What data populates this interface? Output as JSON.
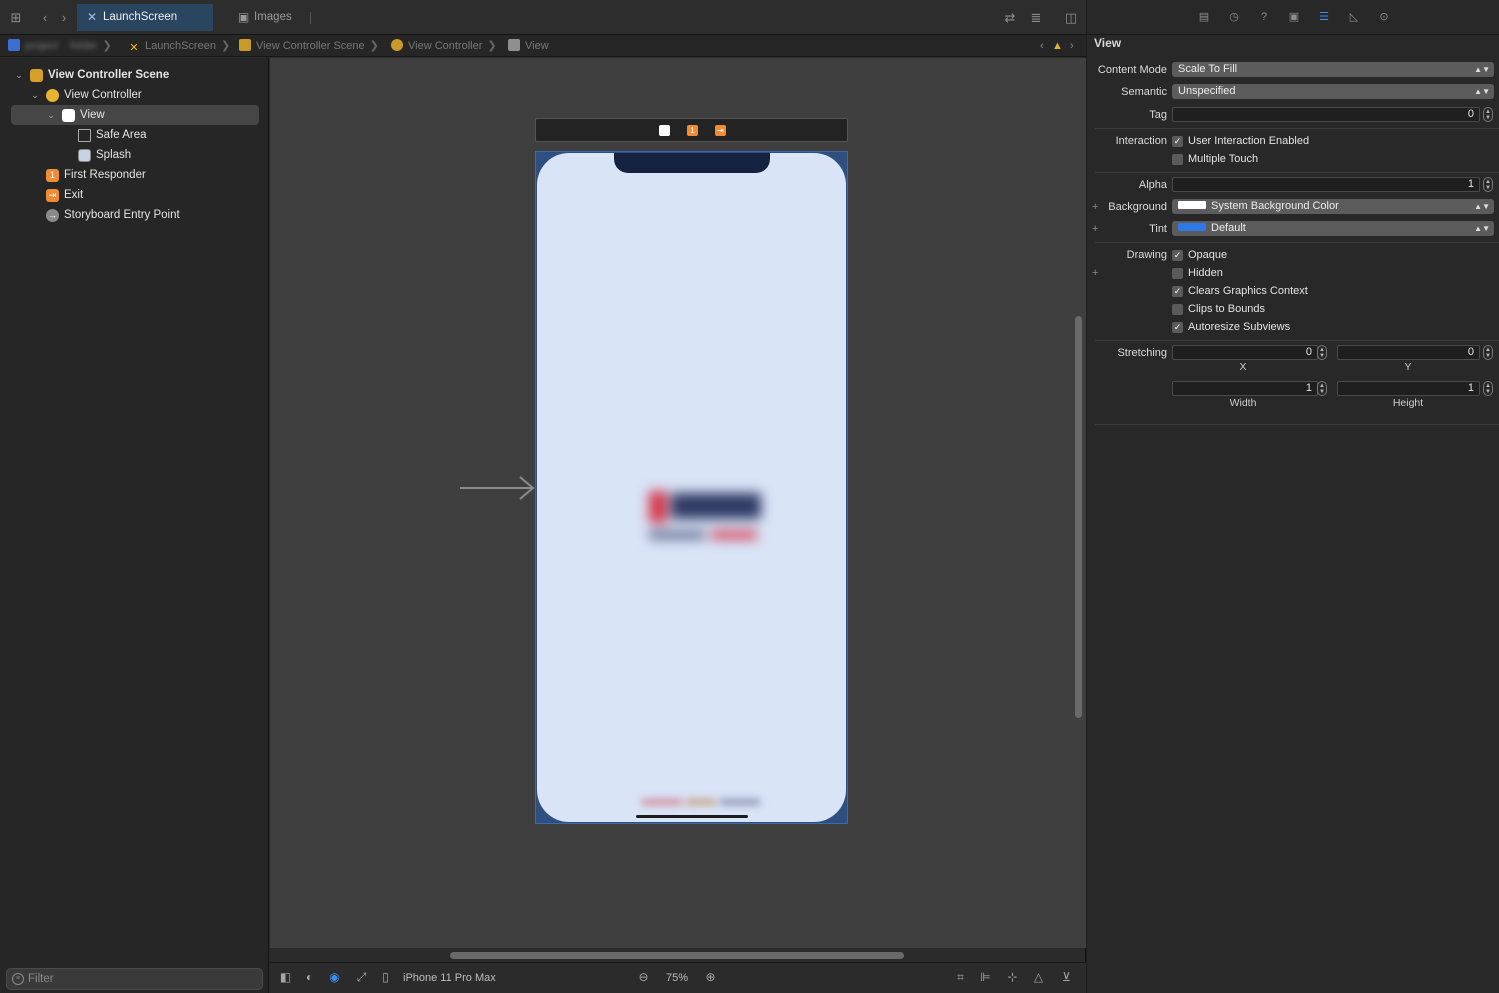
{
  "tabs": {
    "active_label": "LaunchScreen",
    "inactive_label": "Images"
  },
  "jumpbar": {
    "crumbs": [
      "LaunchScreen",
      "View Controller Scene",
      "View Controller",
      "View"
    ],
    "blurred_project": "project",
    "blurred_folder": "folder"
  },
  "navigator": {
    "items": [
      {
        "label": "View Controller Scene",
        "icon": "scene-icon"
      },
      {
        "label": "View Controller",
        "icon": "view-controller-icon"
      },
      {
        "label": "View",
        "icon": "view-icon"
      },
      {
        "label": "Safe Area",
        "icon": "safe-area-icon"
      },
      {
        "label": "Splash",
        "icon": "image-view-icon"
      },
      {
        "label": "First Responder",
        "icon": "first-responder-icon"
      },
      {
        "label": "Exit",
        "icon": "exit-icon"
      },
      {
        "label": "Storyboard Entry Point",
        "icon": "entry-point-icon"
      }
    ],
    "filter_placeholder": "Filter"
  },
  "bottombar": {
    "device": "iPhone 11 Pro Max",
    "zoom": "75%"
  },
  "inspector": {
    "title": "View",
    "content_mode_label": "Content Mode",
    "content_mode_value": "Scale To Fill",
    "semantic_label": "Semantic",
    "semantic_value": "Unspecified",
    "tag_label": "Tag",
    "tag_value": "0",
    "interaction_label": "Interaction",
    "user_interaction": "User Interaction Enabled",
    "multiple_touch": "Multiple Touch",
    "alpha_label": "Alpha",
    "alpha_value": "1",
    "background_label": "Background",
    "background_value": "System Background Color",
    "tint_label": "Tint",
    "tint_value": "Default",
    "drawing_label": "Drawing",
    "opaque": "Opaque",
    "hidden": "Hidden",
    "clears_graphics": "Clears Graphics Context",
    "clips_bounds": "Clips to Bounds",
    "autoresize": "Autoresize Subviews",
    "stretching_label": "Stretching",
    "stretch_x": "0",
    "stretch_y": "0",
    "stretch_w": "1",
    "stretch_h": "1",
    "x_label": "X",
    "y_label": "Y",
    "width_label": "Width",
    "height_label": "Height"
  },
  "colors": {
    "accent": "#3d8fe6",
    "selection_tab": "#2a4560",
    "orange": "#f08c34",
    "yellow": "#f1b32c",
    "device_bg": "#d9e4f7"
  }
}
